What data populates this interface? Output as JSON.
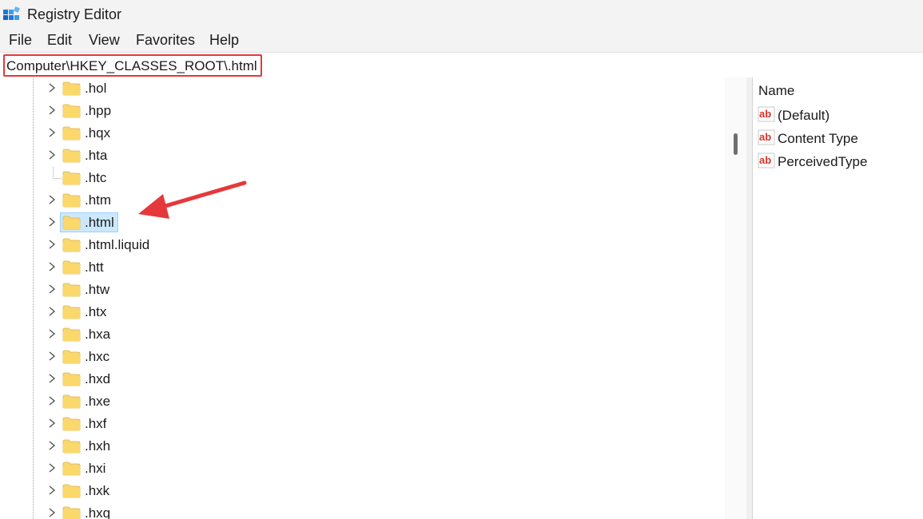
{
  "window": {
    "title": "Registry Editor",
    "app_icon": "registry-editor-icon"
  },
  "menu": [
    "File",
    "Edit",
    "View",
    "Favorites",
    "Help"
  ],
  "address": {
    "path": "Computer\\HKEY_CLASSES_ROOT\\.html"
  },
  "tree": {
    "items": [
      {
        "label": ".hol",
        "expandable": true,
        "selected": false
      },
      {
        "label": ".hpp",
        "expandable": true,
        "selected": false
      },
      {
        "label": ".hqx",
        "expandable": true,
        "selected": false
      },
      {
        "label": ".hta",
        "expandable": true,
        "selected": false
      },
      {
        "label": ".htc",
        "expandable": false,
        "selected": false
      },
      {
        "label": ".htm",
        "expandable": true,
        "selected": false
      },
      {
        "label": ".html",
        "expandable": true,
        "selected": true
      },
      {
        "label": ".html.liquid",
        "expandable": true,
        "selected": false
      },
      {
        "label": ".htt",
        "expandable": true,
        "selected": false
      },
      {
        "label": ".htw",
        "expandable": true,
        "selected": false
      },
      {
        "label": ".htx",
        "expandable": true,
        "selected": false
      },
      {
        "label": ".hxa",
        "expandable": true,
        "selected": false
      },
      {
        "label": ".hxc",
        "expandable": true,
        "selected": false
      },
      {
        "label": ".hxd",
        "expandable": true,
        "selected": false
      },
      {
        "label": ".hxe",
        "expandable": true,
        "selected": false
      },
      {
        "label": ".hxf",
        "expandable": true,
        "selected": false
      },
      {
        "label": ".hxh",
        "expandable": true,
        "selected": false
      },
      {
        "label": ".hxi",
        "expandable": true,
        "selected": false
      },
      {
        "label": ".hxk",
        "expandable": true,
        "selected": false
      },
      {
        "label": ".hxq",
        "expandable": true,
        "selected": false
      }
    ]
  },
  "values": {
    "column_name": "Name",
    "items": [
      {
        "name": "(Default)",
        "icon": "string-value-icon"
      },
      {
        "name": "Content Type",
        "icon": "string-value-icon"
      },
      {
        "name": "PerceivedType",
        "icon": "string-value-icon"
      }
    ]
  },
  "colors": {
    "annotation_red": "#e5383b",
    "selection_bg": "#cce8ff",
    "folder_yellow": "#f8d775"
  }
}
